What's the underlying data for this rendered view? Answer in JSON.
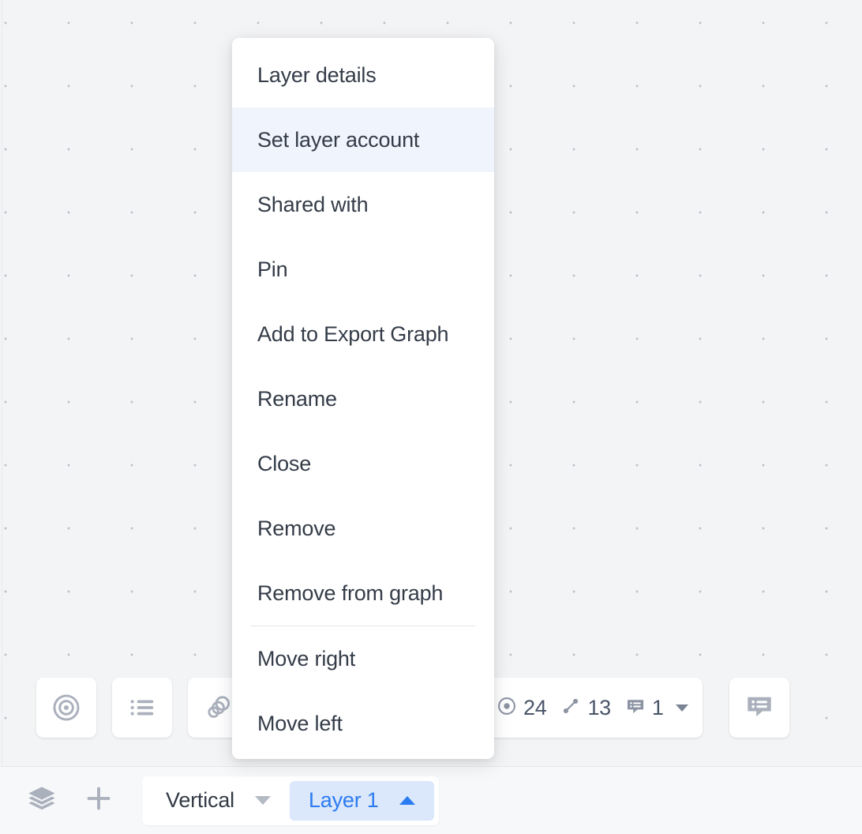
{
  "canvas": {
    "background_color": "#f3f4f5",
    "dot_color": "#bcc1cc"
  },
  "context_menu": {
    "accent_highlight_color": "#eff4fd",
    "items": [
      {
        "label": "Layer details",
        "highlighted": false,
        "separator_after": false
      },
      {
        "label": "Set layer account",
        "highlighted": true,
        "separator_after": false
      },
      {
        "label": "Shared with",
        "highlighted": false,
        "separator_after": false
      },
      {
        "label": "Pin",
        "highlighted": false,
        "separator_after": false
      },
      {
        "label": "Add to Export Graph",
        "highlighted": false,
        "separator_after": false
      },
      {
        "label": "Rename",
        "highlighted": false,
        "separator_after": false
      },
      {
        "label": "Close",
        "highlighted": false,
        "separator_after": false
      },
      {
        "label": "Remove",
        "highlighted": false,
        "separator_after": false
      },
      {
        "label": "Remove from graph",
        "highlighted": false,
        "separator_after": true
      },
      {
        "label": "Move right",
        "highlighted": false,
        "separator_after": false
      },
      {
        "label": "Move left",
        "highlighted": false,
        "separator_after": false
      }
    ]
  },
  "floating_toolbar": {
    "buttons": [
      {
        "icon": "target-icon",
        "name": "target-tool-button"
      },
      {
        "icon": "list-icon",
        "name": "list-tool-button"
      },
      {
        "icon": "link-rings-icon",
        "name": "link-tool-button"
      }
    ]
  },
  "stats_pill": {
    "stats": [
      {
        "icon": "node-dot-icon",
        "value": "24"
      },
      {
        "icon": "edge-link-icon",
        "value": "13"
      },
      {
        "icon": "note-icon",
        "value": "1"
      }
    ],
    "has_dropdown_caret": true
  },
  "comment_button": {
    "icon": "comment-icon",
    "name": "comment-button"
  },
  "layer_bar": {
    "layers_icon": "layers-icon",
    "add_icon": "plus-icon",
    "tabs": [
      {
        "label": "Vertical",
        "active": false,
        "caret": "down"
      },
      {
        "label": "Layer 1",
        "active": true,
        "caret": "up"
      }
    ],
    "active_color": "#2b7cf0",
    "active_background": "#dbe7fb"
  }
}
